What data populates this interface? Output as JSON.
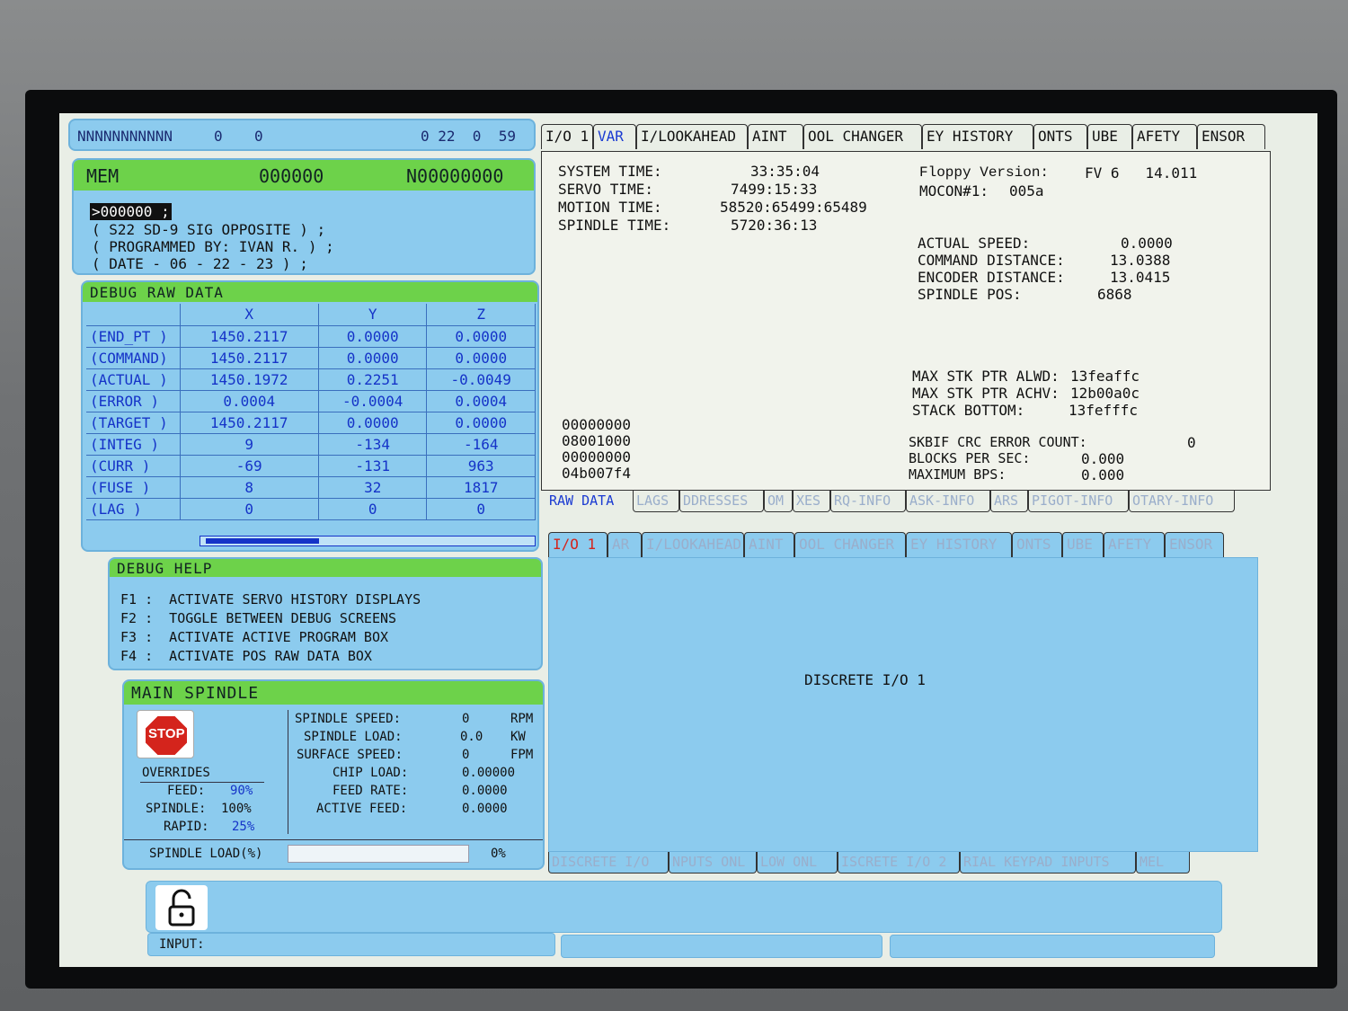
{
  "status_bar": {
    "left": "NNNNNNNNNNN",
    "v1": "0",
    "v2": "0",
    "right": "0 22  0  59"
  },
  "program": {
    "mode": "MEM",
    "number": "000000",
    "seq": "N00000000",
    "lines": [
      ">000000 ;",
      "( S22 SD-9 SIG OPPOSITE ) ;",
      "( PROGRAMMED BY: IVAN R. ) ;",
      "( DATE - 06 - 22 - 23 ) ;"
    ]
  },
  "debug_raw": {
    "title": "DEBUG RAW DATA",
    "headers": [
      "X",
      "Y",
      "Z"
    ],
    "rows": [
      {
        "label": "(END_PT  )",
        "x": "1450.2117",
        "y": "0.0000",
        "z": "0.0000"
      },
      {
        "label": "(COMMAND)",
        "x": "1450.2117",
        "y": "0.0000",
        "z": "0.0000"
      },
      {
        "label": "(ACTUAL  )",
        "x": "1450.1972",
        "y": "0.2251",
        "z": "-0.0049"
      },
      {
        "label": "(ERROR   )",
        "x": "0.0004",
        "y": "-0.0004",
        "z": "0.0004"
      },
      {
        "label": "(TARGET  )",
        "x": "1450.2117",
        "y": "0.0000",
        "z": "0.0000"
      },
      {
        "label": "(INTEG   )",
        "x": "9",
        "y": "-134",
        "z": "-164"
      },
      {
        "label": "(CURR    )",
        "x": "-69",
        "y": "-131",
        "z": "963"
      },
      {
        "label": "(FUSE    )",
        "x": "8",
        "y": "32",
        "z": "1817"
      },
      {
        "label": "(LAG     )",
        "x": "0",
        "y": "0",
        "z": "0"
      }
    ]
  },
  "debug_help": {
    "title": "DEBUG HELP",
    "lines": [
      "F1 :  ACTIVATE SERVO HISTORY DISPLAYS",
      "F2 :  TOGGLE BETWEEN DEBUG SCREENS",
      "F3 :  ACTIVATE ACTIVE PROGRAM BOX",
      "F4 :  ACTIVATE POS RAW DATA BOX"
    ]
  },
  "spindle": {
    "title": "MAIN SPINDLE",
    "stop_label": "STOP",
    "overrides_label": "OVERRIDES",
    "feed_label": "FEED:",
    "feed_value": "90%",
    "spindle_label": "SPINDLE:",
    "spindle_value": "100%",
    "rapid_label": "RAPID:",
    "rapid_value": "25%",
    "stats": [
      {
        "label": "SPINDLE SPEED:",
        "value": "0",
        "unit": "RPM"
      },
      {
        "label": "SPINDLE LOAD:",
        "value": "0.0",
        "unit": "KW"
      },
      {
        "label": "SURFACE SPEED:",
        "value": "0",
        "unit": "FPM"
      },
      {
        "label": "CHIP LOAD:",
        "value": "0.00000",
        "unit": ""
      },
      {
        "label": "FEED RATE:",
        "value": "0.0000",
        "unit": ""
      },
      {
        "label": "ACTIVE FEED:",
        "value": "0.0000",
        "unit": ""
      }
    ],
    "load_label": "SPINDLE LOAD(%)",
    "load_value": "0%",
    "load_fraction": 0
  },
  "top_tabs": [
    "I/O 1",
    "VAR",
    "I/LOOKAHEAD",
    "AINT",
    "OOL CHANGER",
    "EY HISTORY",
    "ONTS",
    "UBE",
    "AFETY",
    "ENSOR"
  ],
  "var_info": {
    "system_time_label": "SYSTEM TIME:",
    "system_time": "33:35:04",
    "servo_time_label": "SERVO TIME:",
    "servo_time": "7499:15:33",
    "motion_time_label": "MOTION TIME:",
    "motion_time": "58520:65499:65489",
    "spindle_time_label": "SPINDLE TIME:",
    "spindle_time": "5720:36:13",
    "floppy_label": "Floppy Version:",
    "floppy_value": "FV 6   14.011",
    "mocon_label": "MOCON#1:",
    "mocon_value": "005a",
    "actual_speed_label": "ACTUAL SPEED:",
    "actual_speed": "0.0000",
    "command_distance_label": "COMMAND DISTANCE:",
    "command_distance": "13.0388",
    "encoder_distance_label": "ENCODER DISTANCE:",
    "encoder_distance": "13.0415",
    "spindle_pos_label": "SPINDLE POS:",
    "spindle_pos": "6868",
    "max_stk_alwd_label": "MAX STK PTR ALWD:",
    "max_stk_alwd": "13feaffc",
    "max_stk_achv_label": "MAX STK PTR ACHV:",
    "max_stk_achv": "12b00a0c",
    "stack_bottom_label": "STACK BOTTOM:",
    "stack_bottom": "13fefffc",
    "hex_lines": [
      "00000000",
      "08001000",
      "00000000",
      "04b007f4"
    ],
    "skbif_label": "SKBIF CRC ERROR COUNT:",
    "skbif_value": "0",
    "bps_label": "BLOCKS PER SEC:",
    "bps_value": "0.000",
    "max_bps_label": "MAXIMUM BPS:",
    "max_bps_value": "0.000"
  },
  "raw_tabs": [
    "RAW DATA",
    "LAGS",
    "DDRESSES",
    "OM",
    "XES",
    "RQ-INFO",
    "ASK-INFO",
    "ARS",
    "PIGOT-INFO",
    "OTARY-INFO"
  ],
  "lower_top_tabs": [
    "I/O 1",
    "AR",
    "I/LOOKAHEAD",
    "AINT",
    "OOL CHANGER",
    "EY HISTORY",
    "ONTS",
    "UBE",
    "AFETY",
    "ENSOR"
  ],
  "discrete": {
    "title": "DISCRETE I/O 1"
  },
  "lower_bottom_tabs": [
    "DISCRETE I/O",
    "NPUTS ONL",
    "LOW ONL",
    "ISCRETE I/O 2",
    "RIAL KEYPAD INPUTS",
    "MEL"
  ],
  "input": {
    "label": "INPUT:",
    "value": ""
  },
  "colors": {
    "panel_blue": "#8ccbee",
    "header_green": "#6dd24a",
    "accent_blue": "#1533c8",
    "stop_red": "#d4241c"
  }
}
